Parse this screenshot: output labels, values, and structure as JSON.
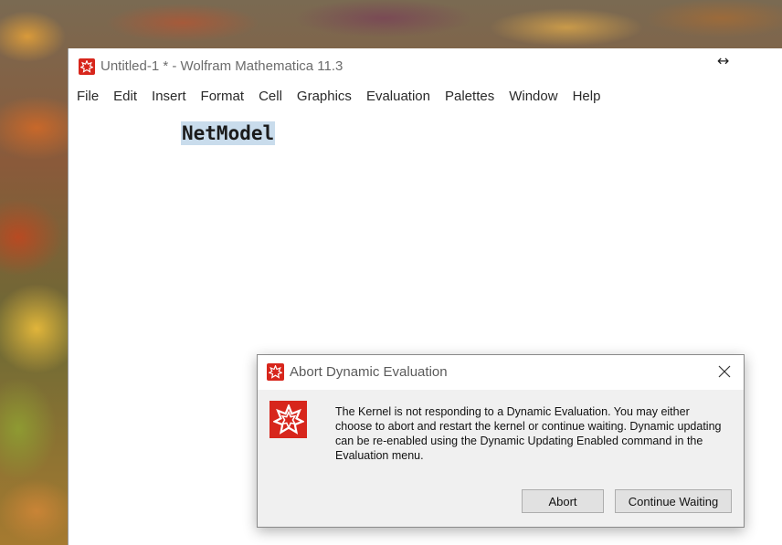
{
  "window": {
    "title": "Untitled-1 * - Wolfram Mathematica 11.3",
    "resize_glyph": "↔"
  },
  "menu": [
    {
      "label": "File"
    },
    {
      "label": "Edit"
    },
    {
      "label": "Insert"
    },
    {
      "label": "Format"
    },
    {
      "label": "Cell"
    },
    {
      "label": "Graphics"
    },
    {
      "label": "Evaluation"
    },
    {
      "label": "Palettes"
    },
    {
      "label": "Window"
    },
    {
      "label": "Help"
    }
  ],
  "notebook": {
    "cell_text": "NetModel"
  },
  "dialog": {
    "title": "Abort Dynamic Evaluation",
    "message": "The Kernel is not responding to a Dynamic Evaluation.  You may either choose to abort and restart the kernel or continue waiting.  Dynamic updating can be re-enabled using the Dynamic Updating Enabled command in the Evaluation menu.",
    "abort_label": "Abort",
    "continue_label": "Continue Waiting"
  },
  "icons": {
    "app": "mathematica-logo-icon",
    "dialog": "mathematica-logo-icon",
    "close": "close-icon",
    "resize": "resize-horizontal-icon"
  },
  "colors": {
    "brand_red": "#d7261c",
    "cell_selection": "#c9dcec",
    "dialog_background": "#f0f0f0"
  }
}
